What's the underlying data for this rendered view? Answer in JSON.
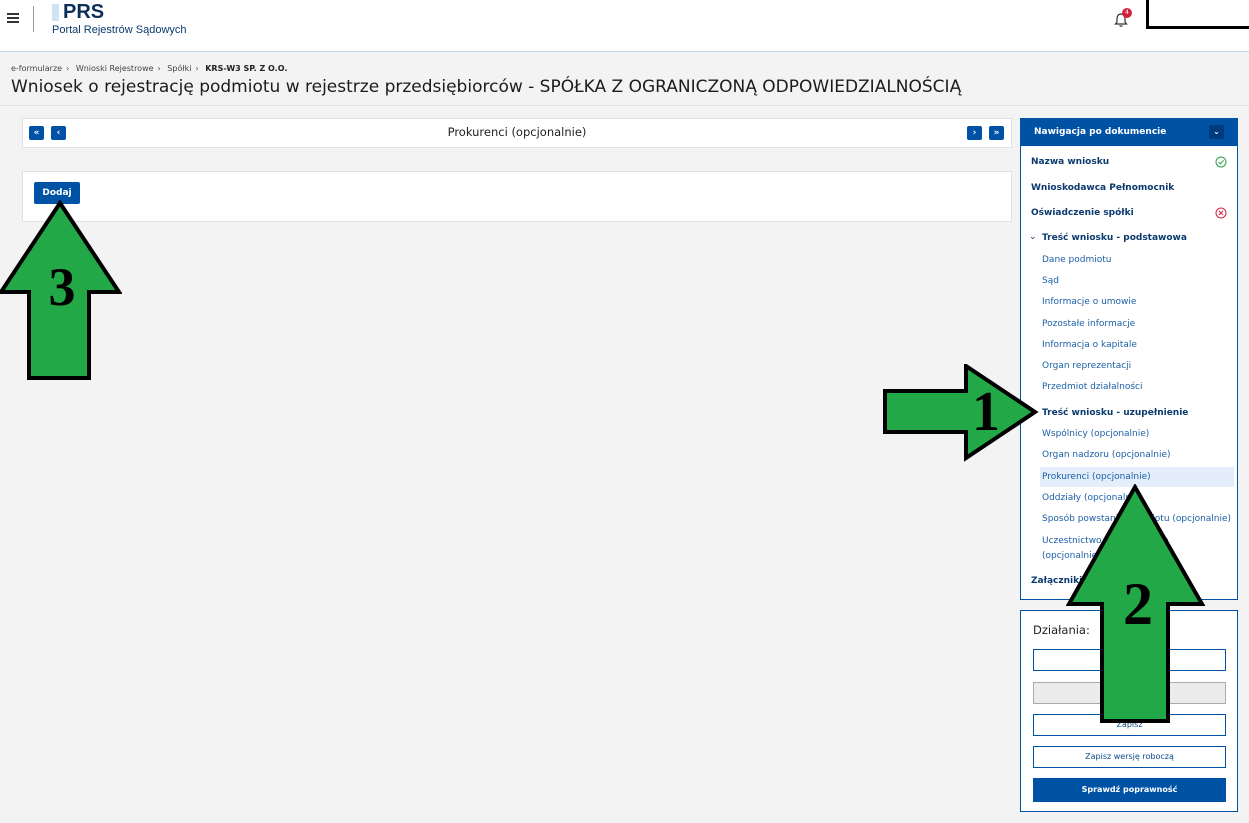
{
  "header": {
    "brand_title": "PRS",
    "brand_subtitle": "Portal Rejestrów Sądowych",
    "notification_count": "4"
  },
  "breadcrumb": [
    "e-formularze",
    "Wnioski Rejestrowe",
    "Spółki",
    "KRS-W3 SP. Z O.O."
  ],
  "page_title": "Wniosek o rejestrację podmiotu w rejestrze przedsiębiorców - SPÓŁKA Z OGRANICZONĄ ODPOWIEDZIALNOŚCIĄ",
  "pager": {
    "first": "«",
    "prev": "‹",
    "title": "Prokurenci (opcjonalnie)",
    "next": "›",
    "last": "»"
  },
  "panel": {
    "add_label": "Dodaj"
  },
  "nav": {
    "title": "Nawigacja po dokumencie",
    "items": [
      {
        "label": "Nazwa wniosku",
        "status": "ok"
      },
      {
        "label": "Wnioskodawca Pełnomocnik"
      },
      {
        "label": "Oświadczenie spółki",
        "status": "error"
      },
      {
        "label": "Treść wniosku - podstawowa"
      },
      {
        "label": "Dane podmiotu"
      },
      {
        "label": "Sąd"
      },
      {
        "label": "Informacje o umowie"
      },
      {
        "label": "Pozostałe informacje"
      },
      {
        "label": "Informacja o kapitale"
      },
      {
        "label": "Organ reprezentacji"
      },
      {
        "label": "Przedmiot działalności"
      },
      {
        "label": "Treść wniosku - uzupełnienie"
      },
      {
        "label": "Wspólnicy (opcjonalnie)"
      },
      {
        "label": "Organ nadzoru (opcjonalnie)"
      },
      {
        "label": "Prokurenci (opcjonalnie)"
      },
      {
        "label": "Oddziały (opcjonalnie)"
      },
      {
        "label": "Sposób powstania podmiotu (opcjonalnie)"
      },
      {
        "label": "Uczestnictwo w innej spółce"
      },
      {
        "label": "(opcjonalnie)"
      },
      {
        "label": "Załączniki"
      }
    ]
  },
  "actions": {
    "title": "Działania:",
    "buttons": [
      "",
      "",
      "Zapisz",
      "Zapisz wersję roboczą",
      "Sprawdź poprawność"
    ]
  },
  "annotations": [
    "1",
    "2",
    "3"
  ],
  "colors": {
    "primary": "#0052a5",
    "arrow_fill": "#22a846",
    "arrow_stroke": "#000000"
  }
}
